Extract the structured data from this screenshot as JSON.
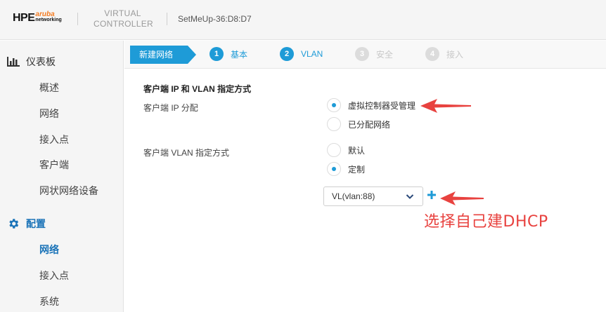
{
  "header": {
    "logo_main": "HPE",
    "logo_aruba": "aruba",
    "logo_networking": "networking",
    "product_line1": "VIRTUAL",
    "product_line2": "CONTROLLER",
    "hostname": "SetMeUp-36:D8:D7"
  },
  "sidebar": {
    "dashboard": {
      "icon": "bar-chart-icon",
      "label": "仪表板",
      "items": [
        "概述",
        "网络",
        "接入点",
        "客户端",
        "网状网络设备"
      ]
    },
    "config": {
      "icon": "gear-icon",
      "label": "配置",
      "items": [
        "网络",
        "接入点",
        "系统"
      ],
      "active_item": "网络"
    }
  },
  "wizard": {
    "current": "新建网络",
    "steps": [
      {
        "num": "1",
        "label": "基本",
        "state": "done"
      },
      {
        "num": "2",
        "label": "VLAN",
        "state": "active"
      },
      {
        "num": "3",
        "label": "安全",
        "state": "pending"
      },
      {
        "num": "4",
        "label": "接入",
        "state": "pending"
      }
    ]
  },
  "form": {
    "section_title": "客户端 IP 和 VLAN 指定方式",
    "ip_assign": {
      "label": "客户端 IP 分配",
      "options": [
        "虚拟控制器受管理",
        "已分配网络"
      ],
      "selected": "虚拟控制器受管理"
    },
    "vlan_assign": {
      "label": "客户端 VLAN 指定方式",
      "options": [
        "默认",
        "定制"
      ],
      "selected": "定制"
    },
    "vlan_select": {
      "value": "VL(vlan:88)"
    }
  },
  "annotation": {
    "text": "选择自己建DHCP",
    "color": "#e8423f"
  },
  "colors": {
    "accent": "#1e9bd7",
    "active_nav": "#1a73b8",
    "disabled_step": "#dcdcdc"
  }
}
